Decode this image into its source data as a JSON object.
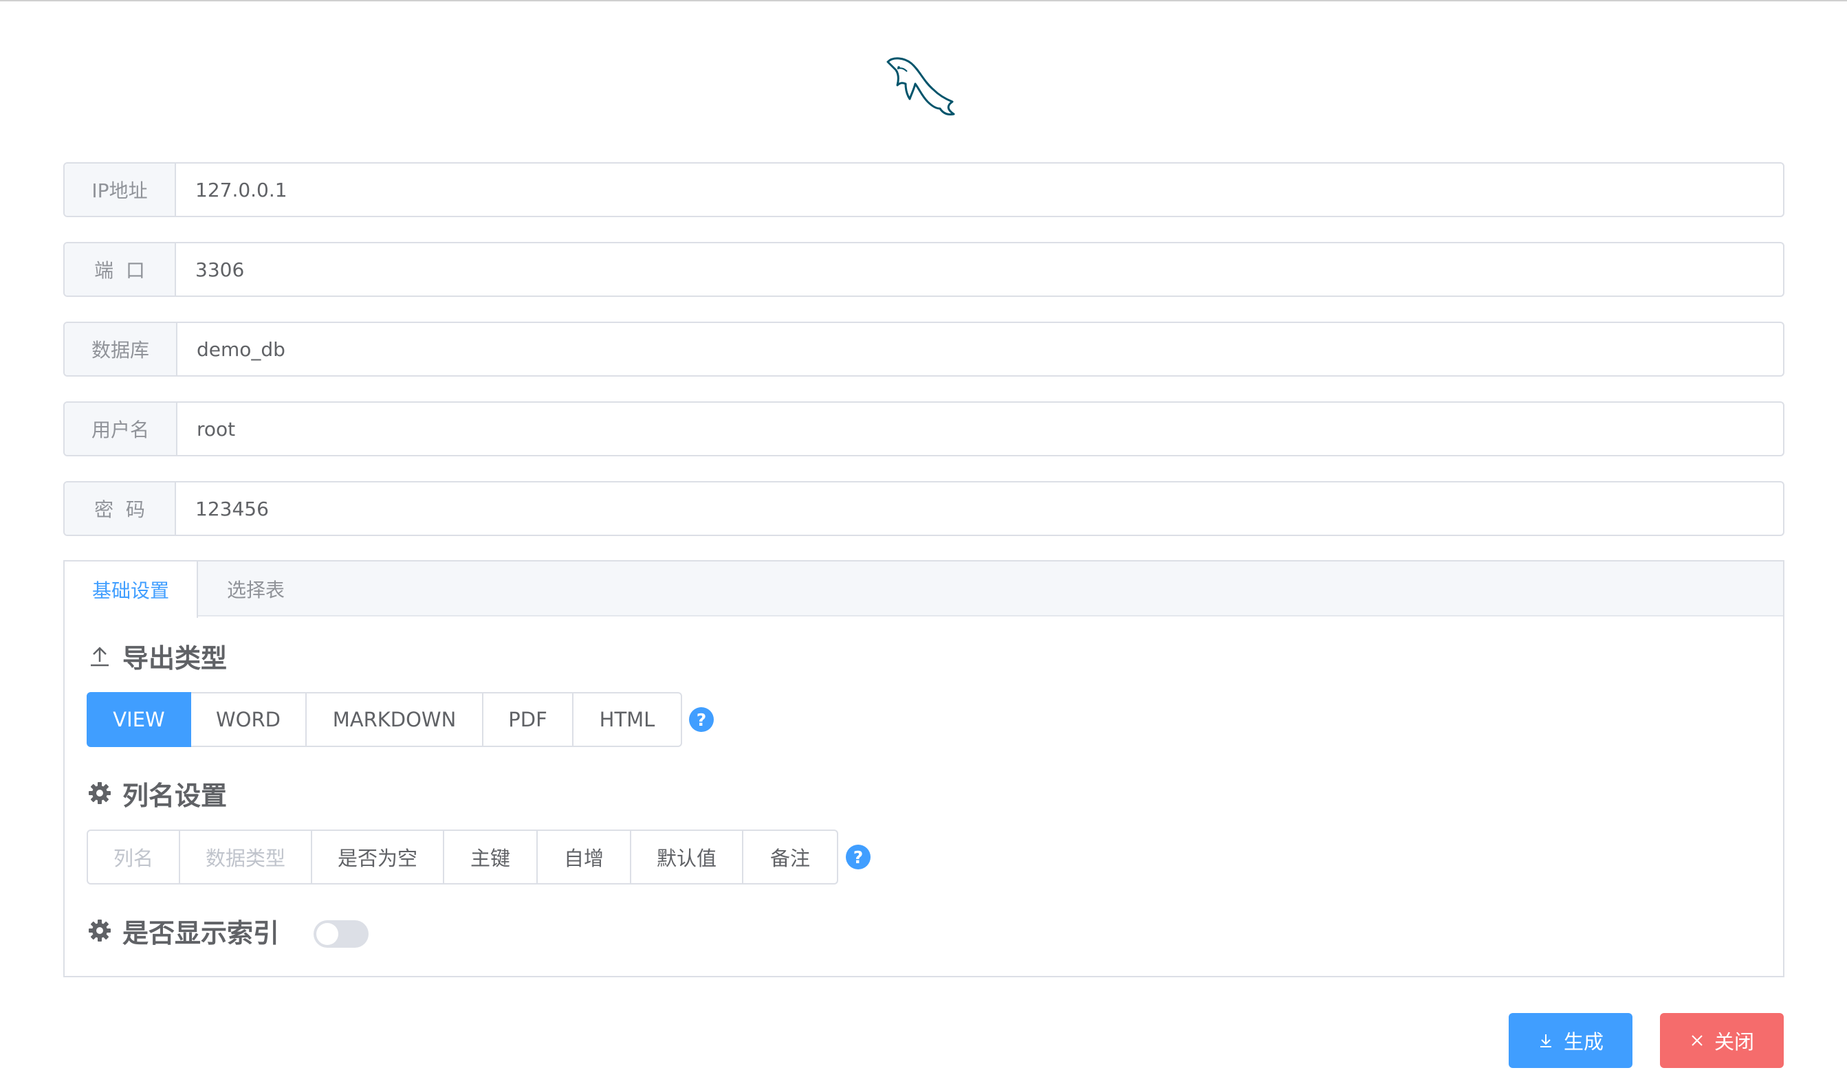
{
  "form": {
    "ip": {
      "label": "IP地址",
      "value": "127.0.0.1"
    },
    "port": {
      "label": "端  口",
      "value": "3306"
    },
    "database": {
      "label": "数据库",
      "value": "demo_db"
    },
    "username": {
      "label": "用户名",
      "value": "root"
    },
    "password": {
      "label": "密  码",
      "value": "123456"
    }
  },
  "tabs": [
    {
      "label": "基础设置",
      "active": true
    },
    {
      "label": "选择表",
      "active": false
    }
  ],
  "export": {
    "title": "导出类型",
    "icon": "upload-icon",
    "options": [
      "VIEW",
      "WORD",
      "MARKDOWN",
      "PDF",
      "HTML"
    ],
    "selected": "VIEW",
    "help": "?"
  },
  "columns": {
    "title": "列名设置",
    "icon": "gear-icon",
    "options": [
      "列名",
      "数据类型",
      "是否为空",
      "主键",
      "自增",
      "默认值",
      "备注"
    ],
    "disabled": [
      "列名",
      "数据类型"
    ],
    "help": "?"
  },
  "index": {
    "title": "是否显示索引",
    "icon": "gear-icon",
    "switch_on": false
  },
  "actions": {
    "generate": {
      "label": "生成",
      "icon": "download-icon"
    },
    "close": {
      "label": "关闭",
      "icon": "close-icon"
    }
  },
  "colors": {
    "primary": "#409eff",
    "danger": "#f56c6c",
    "logo": "#00546b"
  }
}
